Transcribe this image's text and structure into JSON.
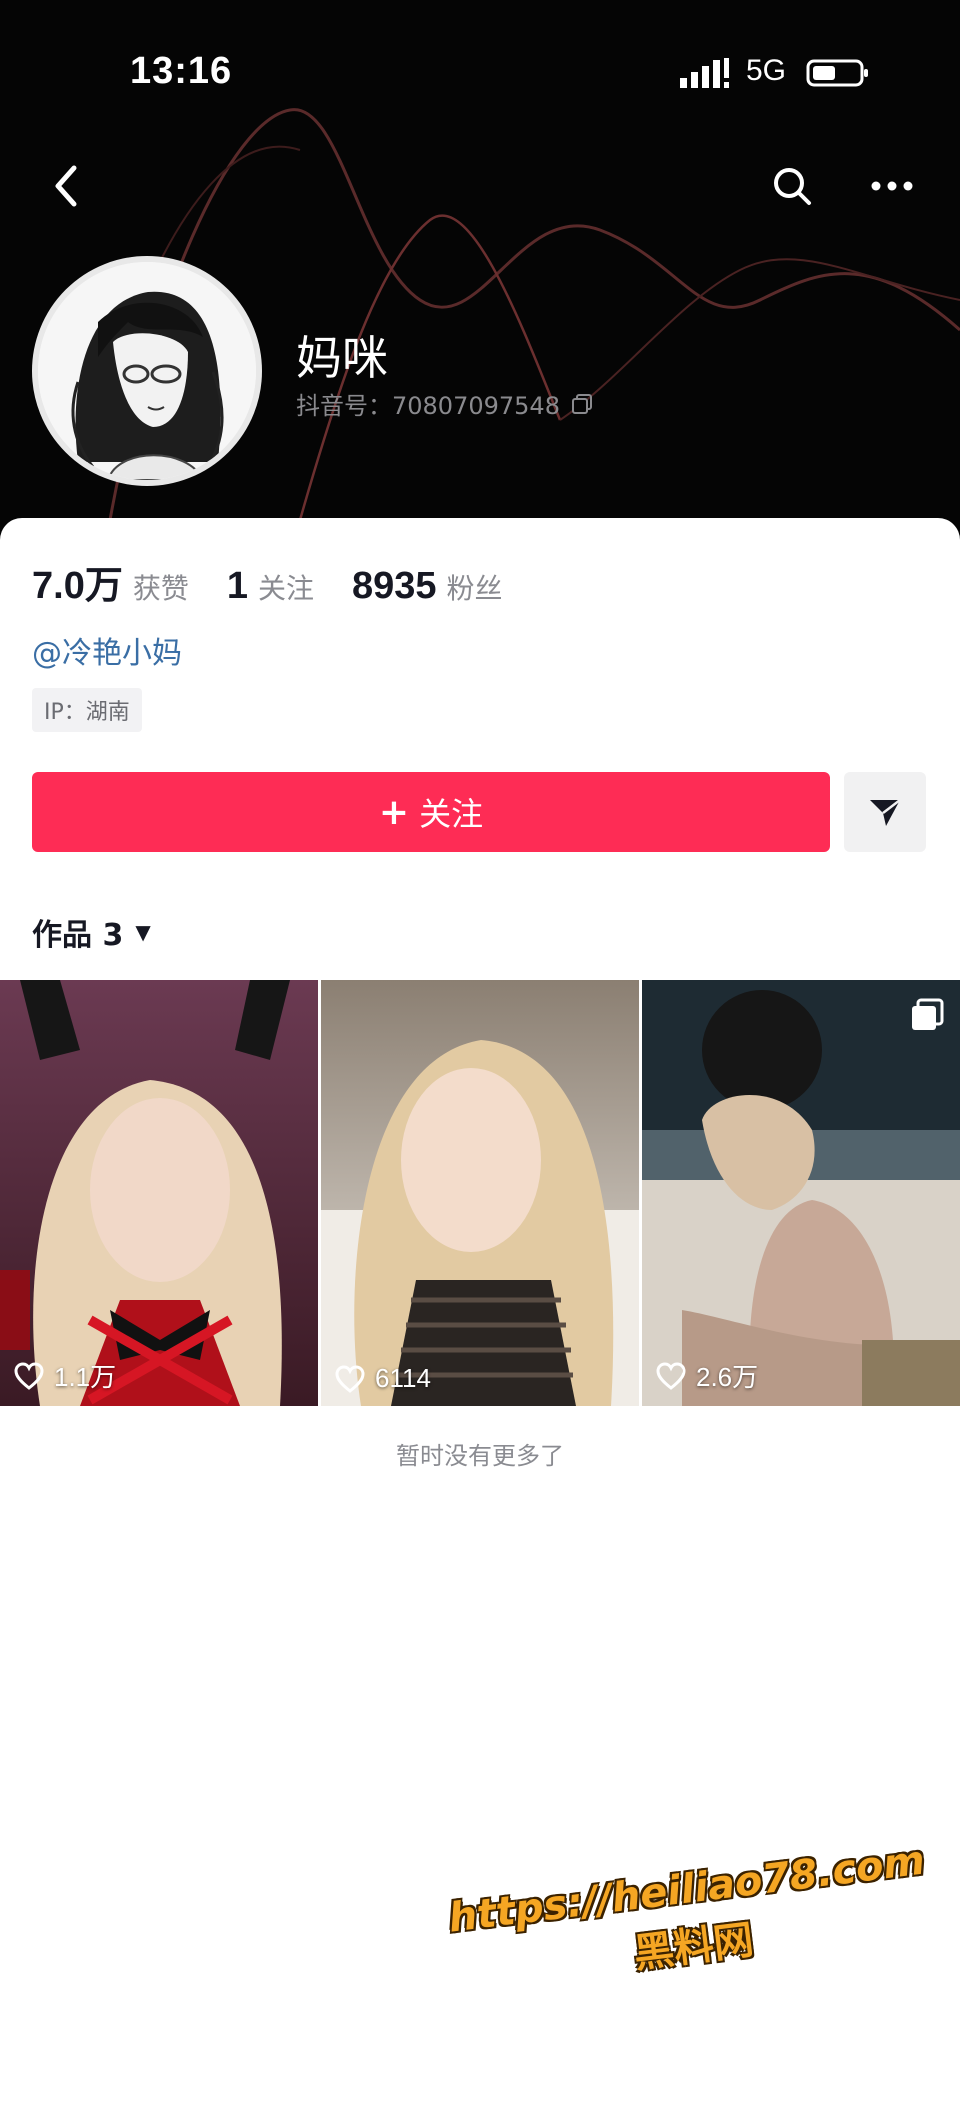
{
  "status_bar": {
    "time": "13:16",
    "network": "5G"
  },
  "profile": {
    "nickname": "妈咪",
    "douyin_id": "抖音号：70807097548",
    "mention": "@冷艳小妈",
    "ip": "IP：湖南"
  },
  "stats": [
    {
      "value": "7.0万",
      "label": "获赞"
    },
    {
      "value": "1",
      "label": "关注"
    },
    {
      "value": "8935",
      "label": "粉丝"
    }
  ],
  "actions": {
    "follow_plus": "+",
    "follow_label": "关注"
  },
  "works": {
    "tab_label": "作品 3",
    "caret": "▼",
    "items": [
      {
        "likes": "1.1万"
      },
      {
        "likes": "6114"
      },
      {
        "likes": "2.6万",
        "multi_image": true
      }
    ],
    "end_text": "暂时没有更多了"
  },
  "watermark": {
    "line1": "https://heiliao78.com",
    "line2": "黑料网"
  },
  "colors": {
    "header_bg": "#050505",
    "follow_button": "#fe2c55",
    "mention": "#3a6ea5",
    "watermark": "#f5a623"
  },
  "icons": [
    "back-arrow-icon",
    "search-icon",
    "more-dots-icon",
    "copy-icon",
    "share-arrow-icon",
    "heart-icon",
    "multi-image-icon",
    "signal-icon",
    "battery-icon"
  ]
}
